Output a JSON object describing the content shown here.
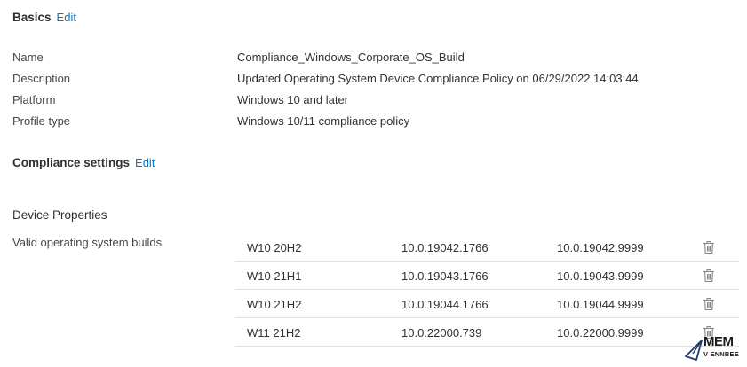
{
  "basics": {
    "title": "Basics",
    "edit_label": "Edit",
    "properties": [
      {
        "label": "Name",
        "value": "Compliance_Windows_Corporate_OS_Build"
      },
      {
        "label": "Description",
        "value": "Updated Operating System Device Compliance Policy on 06/29/2022 14:03:44"
      },
      {
        "label": "Platform",
        "value": "Windows 10 and later"
      },
      {
        "label": "Profile type",
        "value": "Windows 10/11 compliance policy"
      }
    ]
  },
  "compliance_settings": {
    "title": "Compliance settings",
    "edit_label": "Edit"
  },
  "device_properties": {
    "title": "Device Properties",
    "builds_label": "Valid operating system builds",
    "builds": [
      {
        "name": "W10 20H2",
        "min": "10.0.19042.1766",
        "max": "10.0.19042.9999"
      },
      {
        "name": "W10 21H1",
        "min": "10.0.19043.1766",
        "max": "10.0.19043.9999"
      },
      {
        "name": "W10 21H2",
        "min": "10.0.19044.1766",
        "max": "10.0.19044.9999"
      },
      {
        "name": "W11 21H2",
        "min": "10.0.22000.739",
        "max": "10.0.22000.9999"
      }
    ]
  },
  "icons": {
    "delete": "trash-icon",
    "watermark": "paper-plane-icon"
  },
  "colors": {
    "link": "#0078d4",
    "text": "#323130",
    "divider": "#e1dfdd",
    "icon": "#8a8886"
  },
  "watermark": {
    "title": "MEM",
    "subtitle": "V ENNBEE"
  }
}
